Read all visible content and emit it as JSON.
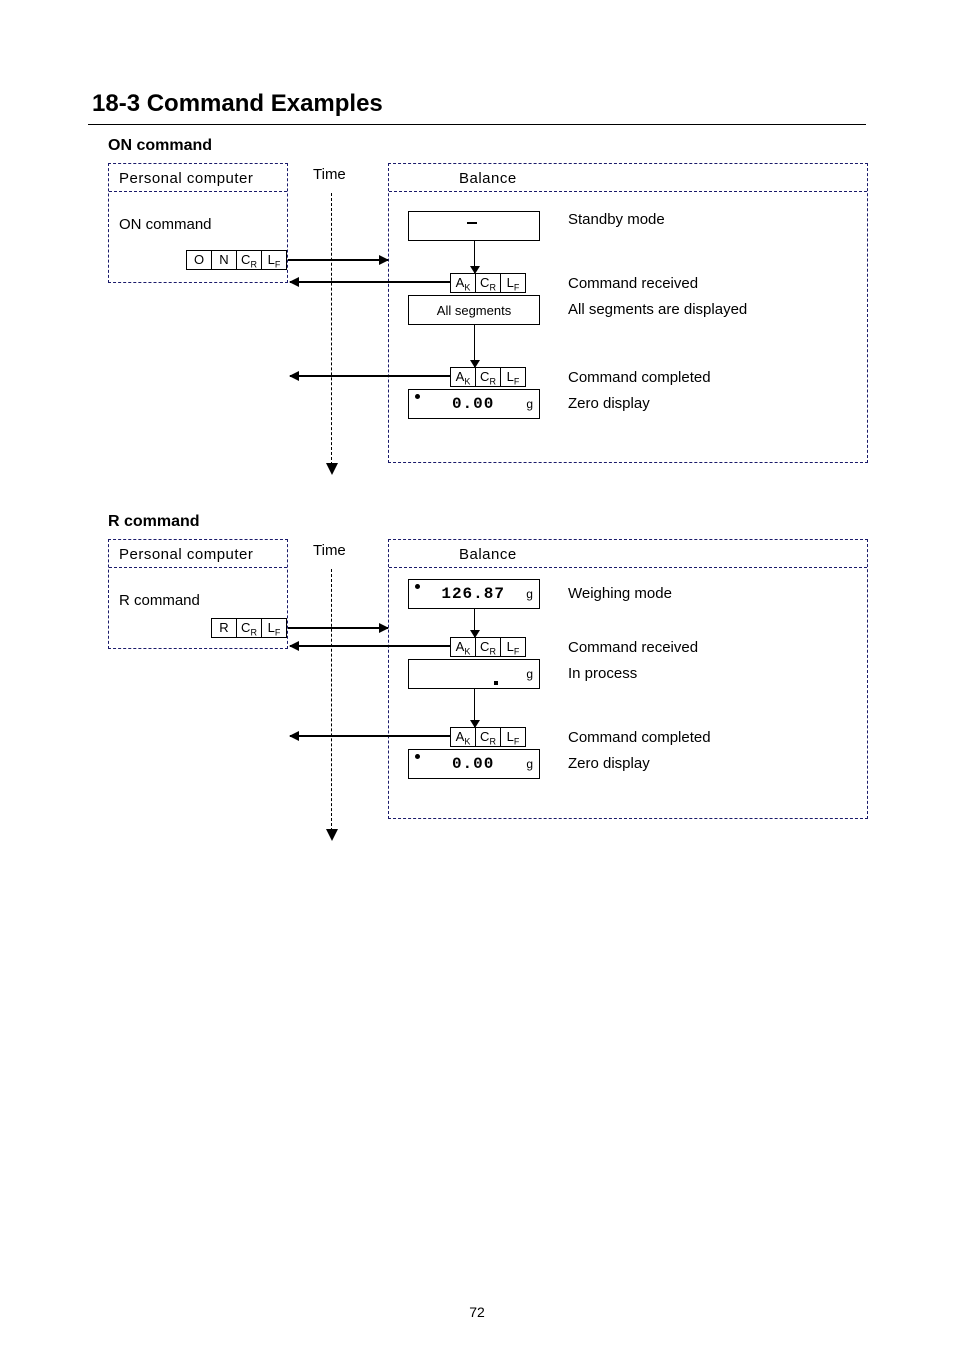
{
  "title": "18-3  Command Examples",
  "page_number": "72",
  "on": {
    "heading": "ON command",
    "pc_header": "Personal computer",
    "time_label": "Time",
    "balance_header": "Balance",
    "cmd_label": "ON command",
    "cmd_bytes_1": "O",
    "cmd_bytes_2": "N",
    "cmd_bytes_3_a": "C",
    "cmd_bytes_3_b": "R",
    "cmd_bytes_4_a": "L",
    "cmd_bytes_4_b": "F",
    "ack_1_a": "A",
    "ack_1_b": "K",
    "state_standby": "Standby mode",
    "state_cmd_recv": "Command received",
    "state_allseg": "All segments are displayed",
    "allseg_box": "All segments",
    "state_cmd_done": "Command completed",
    "state_zero": "Zero display",
    "lcd_zero": "0.00",
    "lcd_unit": "g"
  },
  "r": {
    "heading": "R command",
    "pc_header": "Personal computer",
    "time_label": "Time",
    "balance_header": "Balance",
    "cmd_label": "R command",
    "cmd_bytes_1": "R",
    "cmd_bytes_3_a": "C",
    "cmd_bytes_3_b": "R",
    "cmd_bytes_4_a": "L",
    "cmd_bytes_4_b": "F",
    "ack_1_a": "A",
    "ack_1_b": "K",
    "lcd_weigh": "126.87",
    "lcd_unit": "g",
    "state_weighing": "Weighing mode",
    "state_cmd_recv": "Command received",
    "state_inprocess": "In process",
    "state_cmd_done": "Command completed",
    "state_zero": "Zero display",
    "lcd_zero": "0.00"
  }
}
